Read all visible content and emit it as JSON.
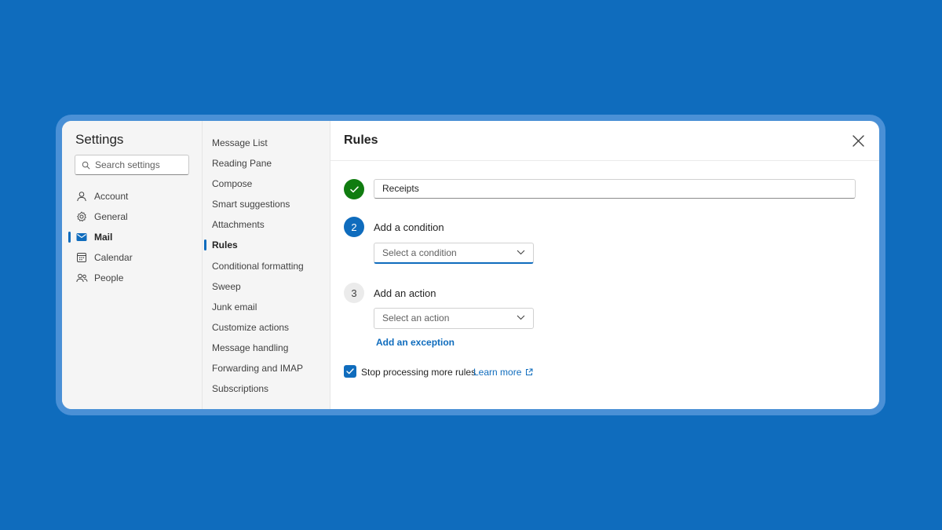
{
  "sidebar": {
    "title": "Settings",
    "search_placeholder": "Search settings",
    "items": [
      {
        "label": "Account",
        "icon": "person-icon"
      },
      {
        "label": "General",
        "icon": "gear-icon"
      },
      {
        "label": "Mail",
        "icon": "mail-icon",
        "active": true
      },
      {
        "label": "Calendar",
        "icon": "calendar-icon"
      },
      {
        "label": "People",
        "icon": "people-icon"
      }
    ]
  },
  "mail_nav": {
    "items": [
      "Message List",
      "Reading Pane",
      "Compose",
      "Smart suggestions",
      "Attachments",
      "Rules",
      "Conditional formatting",
      "Sweep",
      "Junk email",
      "Customize actions",
      "Message handling",
      "Forwarding and IMAP",
      "Subscriptions"
    ],
    "active": "Rules"
  },
  "rule_editor": {
    "title": "Rules",
    "rule_name": "Receipts",
    "step2": {
      "number": "2",
      "label": "Add a condition",
      "dropdown": "Select a condition"
    },
    "step3": {
      "number": "3",
      "label": "Add an action",
      "dropdown": "Select an action"
    },
    "add_exception": "Add an exception",
    "stop_processing": {
      "label": "Stop processing more rules",
      "checked": true
    },
    "learn_more": "Learn more"
  },
  "colors": {
    "background": "#0f6cbd",
    "accent": "#0f6cbd",
    "success": "#107c10"
  }
}
